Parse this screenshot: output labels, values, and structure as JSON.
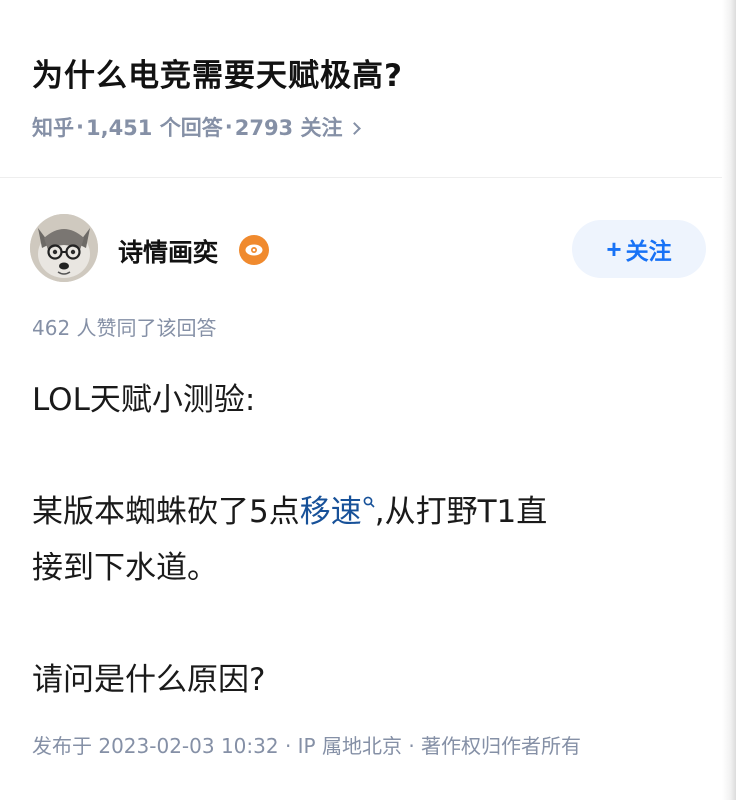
{
  "question": {
    "title": "为什么电竞需要天赋极高?",
    "source": "知乎",
    "answers_count": "1,451 个回答",
    "followers_count": "2793 关注",
    "separator": "·"
  },
  "author": {
    "name": "诗情画奕",
    "follow_label": "关注",
    "follow_plus": "+"
  },
  "answer": {
    "votes_text": "462 人赞同了该回答",
    "line1": "LOL天赋小测验:",
    "line2_prefix": "某版本蜘蛛砍了5点",
    "line2_keyword": "移速",
    "line2_suffix": ",从打野T1直",
    "line3": "接到下水道。",
    "line4": "请问是什么原因?"
  },
  "footer": {
    "text": "发布于 2023-02-03 10:32 · IP 属地北京 · 著作权归作者所有"
  },
  "colors": {
    "accent": "#1772f6",
    "keyword": "#175199",
    "meta": "#8590a6",
    "badge": "#f08a2e"
  },
  "icons": [
    "chevron-right-icon",
    "avatar-dog-image",
    "eye-badge-icon",
    "search-keyword-icon"
  ]
}
